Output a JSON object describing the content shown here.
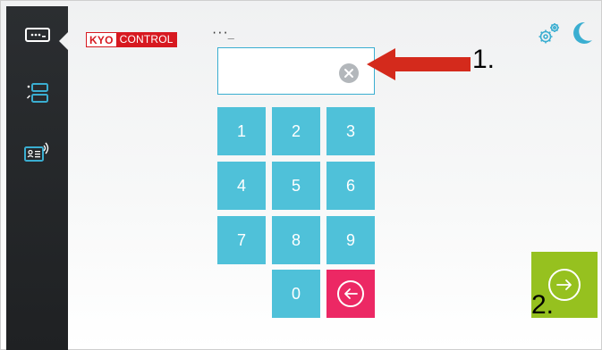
{
  "brand": {
    "logo_left": "KYO",
    "logo_right": "CONTROL"
  },
  "header": {
    "code_mark": "···_"
  },
  "sidebar": {
    "items": [
      {
        "name": "keypad-mode",
        "icon": "pin-keyboard-icon",
        "active": true
      },
      {
        "name": "list-mode",
        "icon": "list-icon",
        "active": false
      },
      {
        "name": "card-mode",
        "icon": "id-card-reader-icon",
        "active": false
      }
    ]
  },
  "pin_field": {
    "value": "",
    "placeholder": "",
    "clear_icon": "clear-icon"
  },
  "keypad": {
    "keys": [
      "1",
      "2",
      "3",
      "4",
      "5",
      "6",
      "7",
      "8",
      "9",
      "0"
    ],
    "backspace_icon": "arrow-left-icon"
  },
  "top_right": {
    "settings_icon": "gears-icon",
    "night_mode_icon": "moon-icon"
  },
  "submit": {
    "icon": "arrow-right-icon"
  },
  "annotations": {
    "label_1": "1.",
    "label_2": "2."
  },
  "colors": {
    "key": "#4fc1d9",
    "backspace": "#ec2864",
    "submit": "#96c11f",
    "sidebar": "#25282b",
    "brand_red": "#d71920",
    "icon_blue": "#3aaed1",
    "annotation_arrow": "#d42a1c"
  }
}
